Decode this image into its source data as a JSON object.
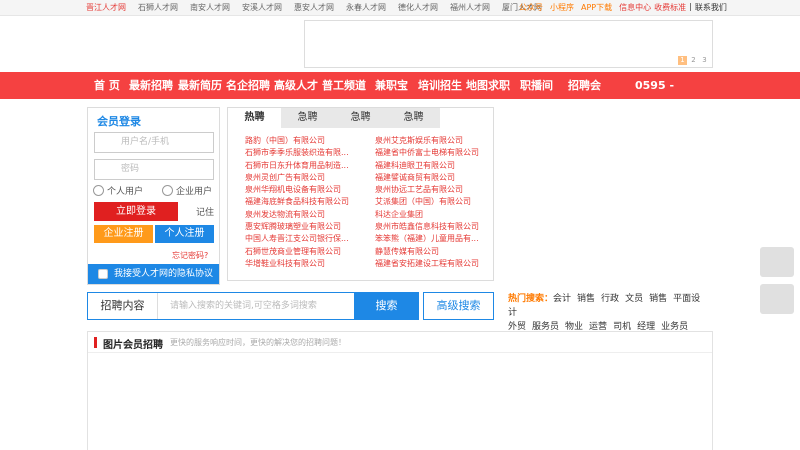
{
  "top_links": [
    "晋江人才网",
    "石狮人才网",
    "南安人才网",
    "安溪人才网",
    "惠安人才网",
    "永春人才网",
    "德化人才网",
    "福州人才网",
    "厦门人才网"
  ],
  "top_right": {
    "gzh": "公众号",
    "mini": "小程序",
    "app": "APP下载",
    "info": "信息中心",
    "fee": "收费标准",
    "sep": "|",
    "contact": "联系我们"
  },
  "banner_pager": [
    "1",
    "2",
    "3"
  ],
  "nav": [
    "首 页",
    "最新招聘",
    "最新简历",
    "名企招聘",
    "高级人才",
    "普工频道",
    "兼职宝",
    "培训招生",
    "地图求职",
    "职播间",
    "招聘会"
  ],
  "phone": "0595 -",
  "login": {
    "title": "会员登录",
    "username_placeholder": "用户名/手机",
    "password_placeholder": "密码",
    "radio_personal": "个人用户",
    "radio_company": "企业用户",
    "login_button": "立即登录",
    "remember": "记住",
    "company_register": "企业注册",
    "personal_register": "个人注册",
    "forgot": "忘记密码?",
    "agree": "我接受人才网的隐私协议"
  },
  "jobs": {
    "tabs": [
      "热聘",
      "急聘",
      "急聘",
      "急聘"
    ],
    "left": [
      "路豹（中国）有限公司",
      "石狮市季季乐服装织造有限...",
      "石狮市日东升体育用品制造...",
      "泉州灵创广告有限公司",
      "泉州华翔机电设备有限公司",
      "福建海底鲜食品科技有限公司",
      "泉州发达物流有限公司",
      "惠安辉腾玻璃塑业有限公司",
      "中国人寿晋江支公司银行保...",
      "石狮世茂商业管理有限公司",
      "华增鞋业科技有限公司"
    ],
    "right": [
      "泉州艾克斯娱乐有限公司",
      "福建省中侨富士电梯有限公司",
      "福建科迪眼卫有限公司",
      "福建譬诚商贸有限公司",
      "泉州协远工艺品有限公司",
      "艾派集团（中国）有限公司",
      "科达企业集团",
      "泉州市皓鑫信息科技有限公司",
      "笨笨熊（福建）儿童用品有...",
      "静慧传媒有限公司",
      "福建省安拓建设工程有限公司"
    ]
  },
  "search": {
    "label": "招聘内容",
    "placeholder": "请输入搜索的关键词,可空格多词搜索",
    "button": "搜索",
    "advanced": "高级搜索",
    "hot_label": "热门搜索：",
    "hot_keywords": [
      "会计",
      "销售",
      "行政",
      "文员",
      "销售",
      "平面设计",
      "外贸",
      "服务员",
      "物业",
      "运营",
      "司机",
      "经理",
      "业务员"
    ]
  },
  "section": {
    "title": "图片会员招聘",
    "subtitle": "更快的服务响应时间，更快的解决您的招聘问题！"
  }
}
